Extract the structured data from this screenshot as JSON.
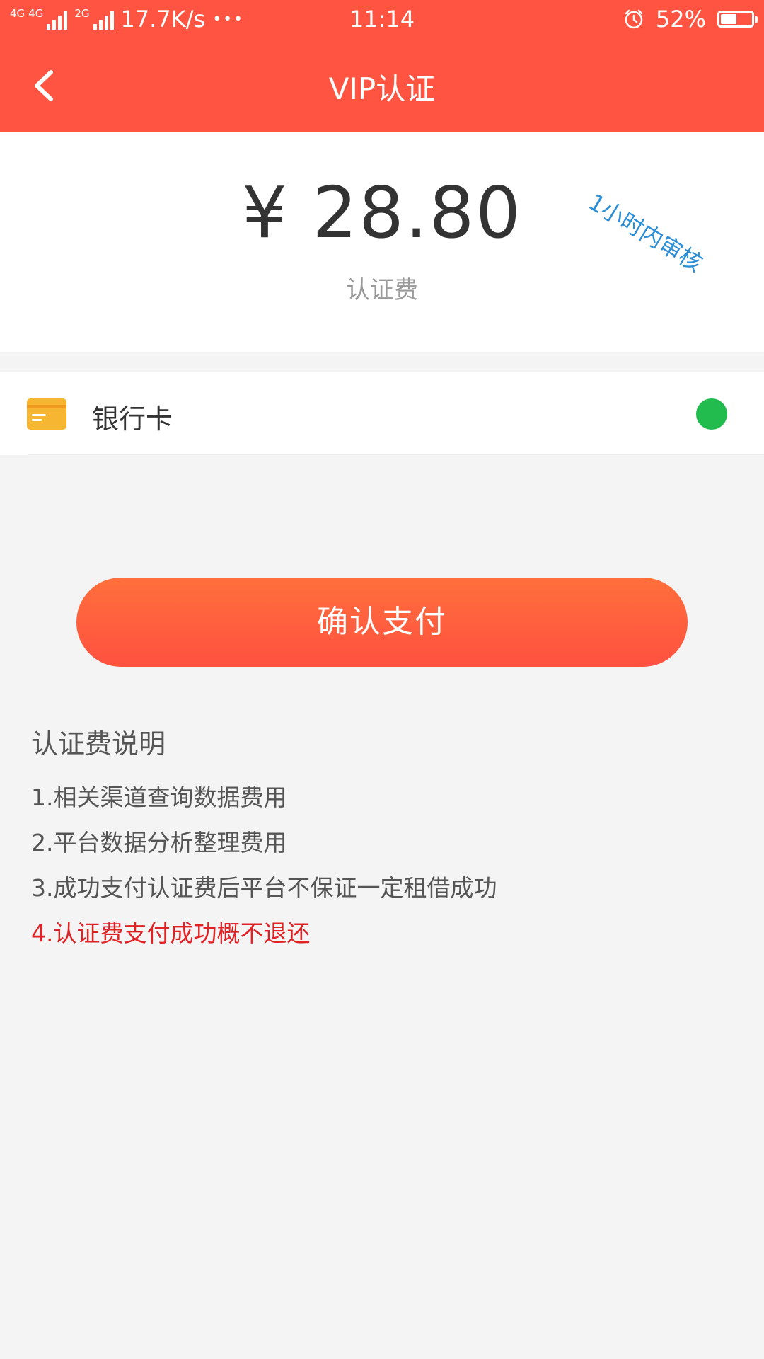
{
  "status_bar": {
    "signal1_tag": "4G",
    "signal1b_tag": "4G",
    "signal2_tag": "2G",
    "speed": "17.7K/s",
    "more": "•••",
    "time": "11:14",
    "battery_percent_text": "52%",
    "battery_level": 0.52
  },
  "nav": {
    "back_icon": "chevron-left-icon",
    "title": "VIP认证"
  },
  "amount_card": {
    "amount": "¥ 28.80",
    "label": "认证费",
    "stamp": "1小时内审核"
  },
  "payment": {
    "method_label": "银行卡",
    "method_icon": "bank-card-icon",
    "selected": true,
    "accent_color": "#22bb4e"
  },
  "confirm_button": {
    "label": "确认支付"
  },
  "notes": {
    "title": "认证费说明",
    "items": [
      "1.相关渠道查询数据费用",
      "2.平台数据分析整理费用",
      "3.成功支付认证费后平台不保证一定租借成功",
      "4.认证费支付成功概不退还"
    ]
  },
  "colors": {
    "header": "#fe5441",
    "button": "#ff5a40",
    "stamp": "#2c8ed6",
    "warning": "#e12225"
  }
}
